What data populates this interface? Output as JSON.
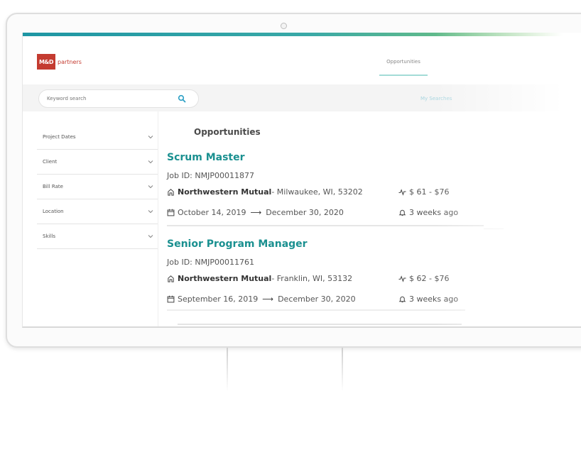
{
  "brand": {
    "logo_badge": "M&D",
    "logo_word": "partners",
    "accent_color": "#1a9090",
    "logo_color": "#c43b30"
  },
  "header": {
    "tabs": [
      {
        "label": "Opportunities",
        "active": true
      },
      {
        "label": "",
        "active": false
      }
    ]
  },
  "search": {
    "placeholder": "Keyword search",
    "icon": "search-icon",
    "my_searches_label": "My Searches"
  },
  "filters": [
    {
      "label": "Project Dates"
    },
    {
      "label": "Client"
    },
    {
      "label": "Bill Rate"
    },
    {
      "label": "Location"
    },
    {
      "label": "Skills"
    }
  ],
  "main": {
    "section_title": "Opportunities",
    "jobs": [
      {
        "title": "Scrum Master",
        "job_id": "Job ID: NMJP00011877",
        "client": "Northwestern Mutual",
        "location": " - Milwaukee, WI, 53202",
        "rate": "$ 61 - $76",
        "start_date": "October 14, 2019",
        "end_date": "December 30, 2020",
        "posted": "3 weeks ago"
      },
      {
        "title": "Senior Program Manager",
        "job_id": "Job ID: NMJP00011761",
        "client": "Northwestern Mutual",
        "location": " - Franklin, WI, 53132",
        "rate": "$ 62 - $76",
        "start_date": "September 16, 2019",
        "end_date": "December 30, 2020",
        "posted": "3 weeks ago"
      }
    ]
  }
}
